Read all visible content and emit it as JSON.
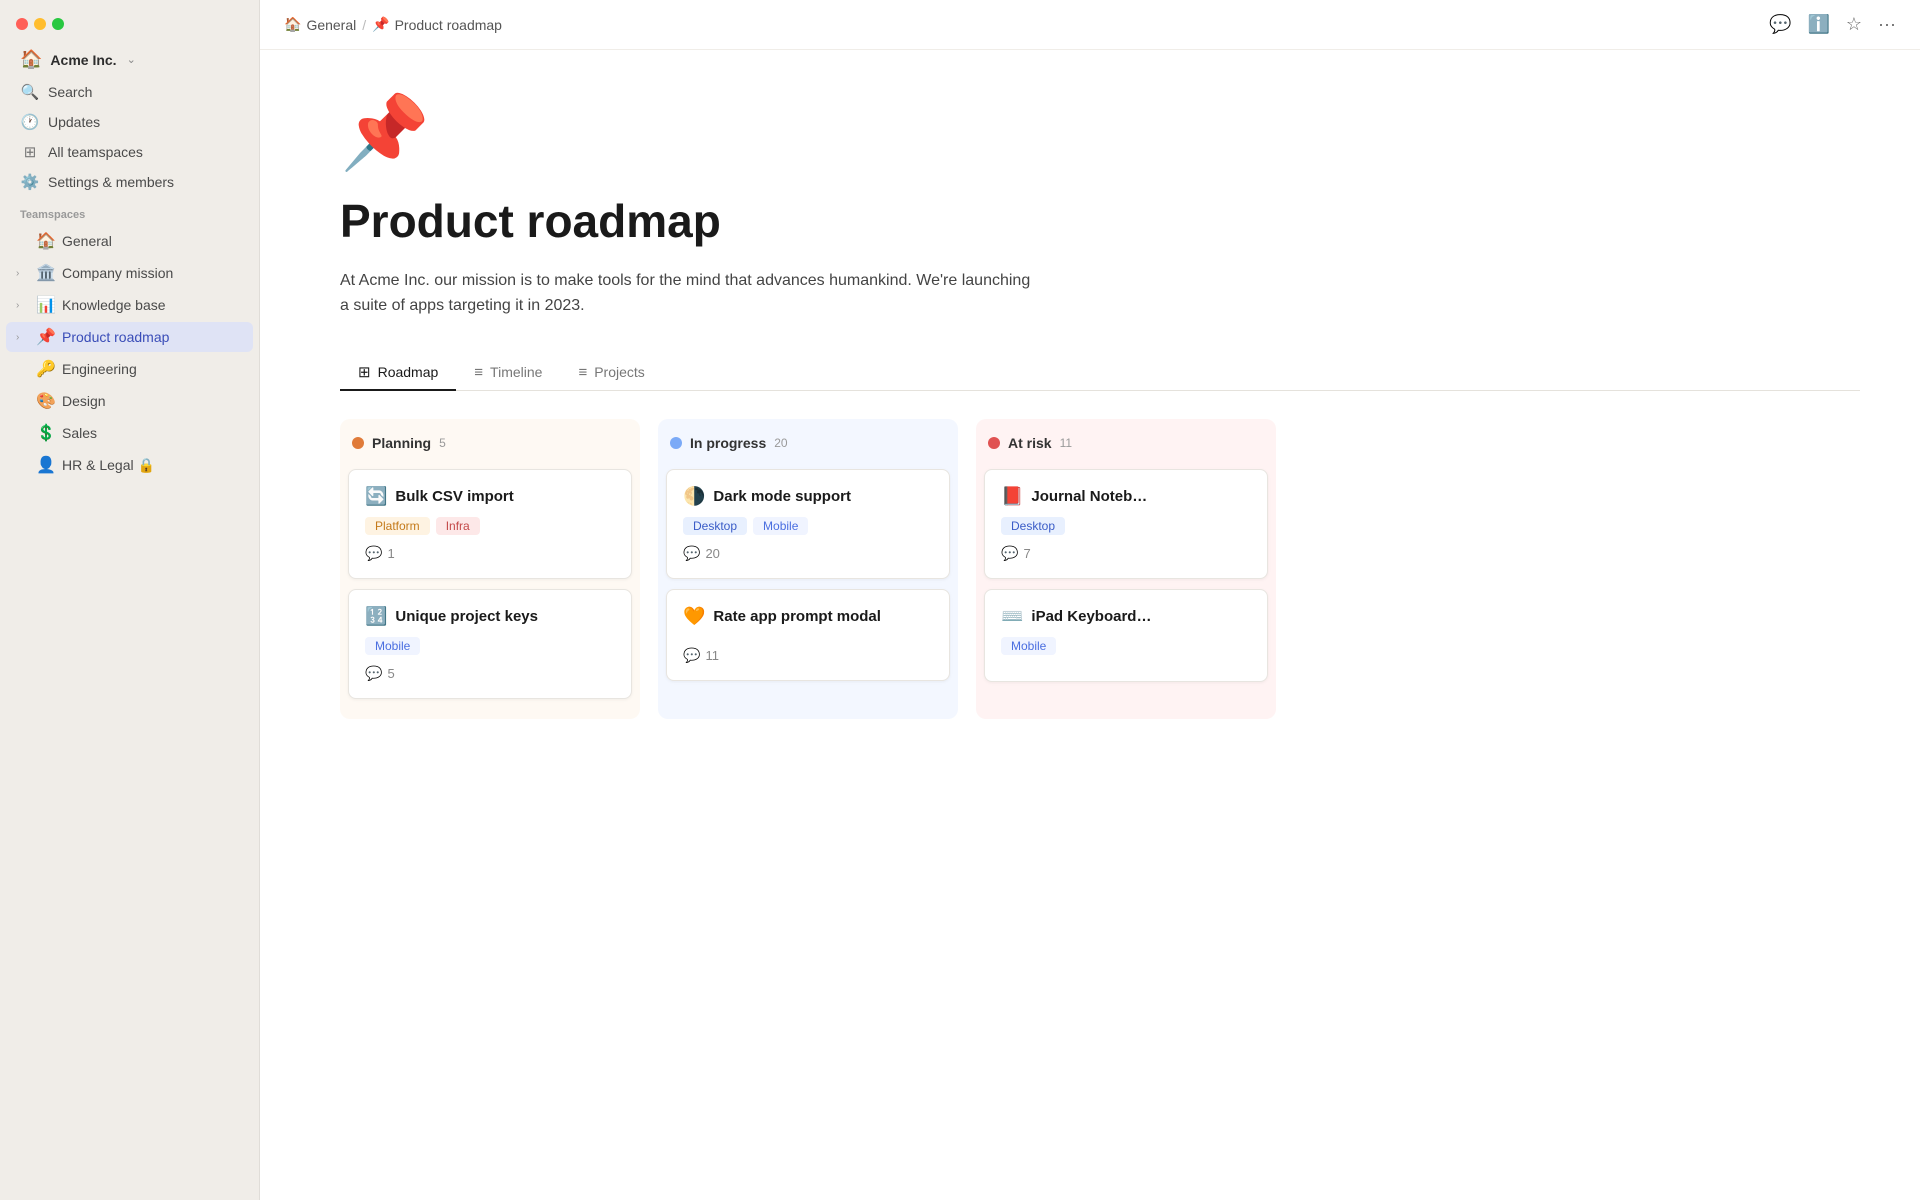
{
  "window": {
    "title": "Product roadmap"
  },
  "sidebar": {
    "workspace": {
      "name": "Acme Inc.",
      "icon": "🏠"
    },
    "nav_items": [
      {
        "id": "search",
        "label": "Search",
        "icon": "🔍"
      },
      {
        "id": "updates",
        "label": "Updates",
        "icon": "🕐"
      },
      {
        "id": "all-teamspaces",
        "label": "All teamspaces",
        "icon": "⊞"
      },
      {
        "id": "settings",
        "label": "Settings & members",
        "icon": "⚙️"
      }
    ],
    "section_label": "Teamspaces",
    "tree_items": [
      {
        "id": "general",
        "label": "General",
        "icon": "🏠",
        "indent": 0,
        "has_chevron": false
      },
      {
        "id": "company-mission",
        "label": "Company mission",
        "icon": "🏛️",
        "indent": 0,
        "has_chevron": true
      },
      {
        "id": "knowledge-base",
        "label": "Knowledge base",
        "icon": "📊",
        "indent": 0,
        "has_chevron": true
      },
      {
        "id": "product-roadmap",
        "label": "Product roadmap",
        "icon": "📌",
        "indent": 0,
        "has_chevron": true,
        "active": true
      },
      {
        "id": "engineering",
        "label": "Engineering",
        "icon": "🔑",
        "indent": 0,
        "has_chevron": false
      },
      {
        "id": "design",
        "label": "Design",
        "icon": "🎨",
        "indent": 0,
        "has_chevron": false
      },
      {
        "id": "sales",
        "label": "Sales",
        "icon": "💲",
        "indent": 0,
        "has_chevron": false
      },
      {
        "id": "hr-legal",
        "label": "HR & Legal 🔒",
        "icon": "👤",
        "indent": 0,
        "has_chevron": false
      }
    ]
  },
  "breadcrumb": {
    "items": [
      {
        "label": "General",
        "icon": "🏠"
      },
      {
        "label": "Product roadmap",
        "icon": "📌"
      }
    ]
  },
  "topbar_actions": {
    "comment_icon": "💬",
    "info_icon": "ℹ️",
    "star_icon": "☆",
    "more_icon": "•••"
  },
  "page": {
    "emoji": "📌",
    "title": "Product roadmap",
    "description": "At Acme Inc. our mission is to make tools for the mind that advances humankind. We're launching a suite of apps targeting it in 2023."
  },
  "tabs": [
    {
      "id": "roadmap",
      "label": "Roadmap",
      "icon": "⊞",
      "active": true
    },
    {
      "id": "timeline",
      "label": "Timeline",
      "icon": "≡",
      "active": false
    },
    {
      "id": "projects",
      "label": "Projects",
      "icon": "≡",
      "active": false
    }
  ],
  "columns": [
    {
      "id": "planning",
      "title": "Planning",
      "count": "5",
      "dot_class": "col-dot-orange",
      "bg_class": "col-planning",
      "cards": [
        {
          "icon": "🔄",
          "title": "Bulk CSV import",
          "tags": [
            {
              "label": "Platform",
              "class": "tag-platform"
            },
            {
              "label": "Infra",
              "class": "tag-infra"
            }
          ],
          "comments": "1"
        },
        {
          "icon": "🔢",
          "title": "Unique project keys",
          "tags": [
            {
              "label": "Mobile",
              "class": "tag-mobile"
            }
          ],
          "comments": "5"
        }
      ]
    },
    {
      "id": "in-progress",
      "title": "In progress",
      "count": "20",
      "dot_class": "col-dot-blue",
      "bg_class": "col-inprogress",
      "cards": [
        {
          "icon": "🌗",
          "title": "Dark mode support",
          "tags": [
            {
              "label": "Desktop",
              "class": "tag-desktop"
            },
            {
              "label": "Mobile",
              "class": "tag-mobile"
            }
          ],
          "comments": "20"
        },
        {
          "icon": "🧡",
          "title": "Rate app prompt modal",
          "tags": [],
          "comments": "11"
        }
      ]
    },
    {
      "id": "at-risk",
      "title": "At risk",
      "count": "11",
      "dot_class": "col-dot-red",
      "bg_class": "col-atrisk",
      "cards": [
        {
          "icon": "📕",
          "title": "Journal Noteb…",
          "tags": [
            {
              "label": "Desktop",
              "class": "tag-desktop"
            }
          ],
          "comments": "7"
        },
        {
          "icon": "⌨️",
          "title": "iPad Keyboard…",
          "tags": [
            {
              "label": "Mobile",
              "class": "tag-mobile"
            }
          ],
          "comments": ""
        }
      ]
    }
  ]
}
